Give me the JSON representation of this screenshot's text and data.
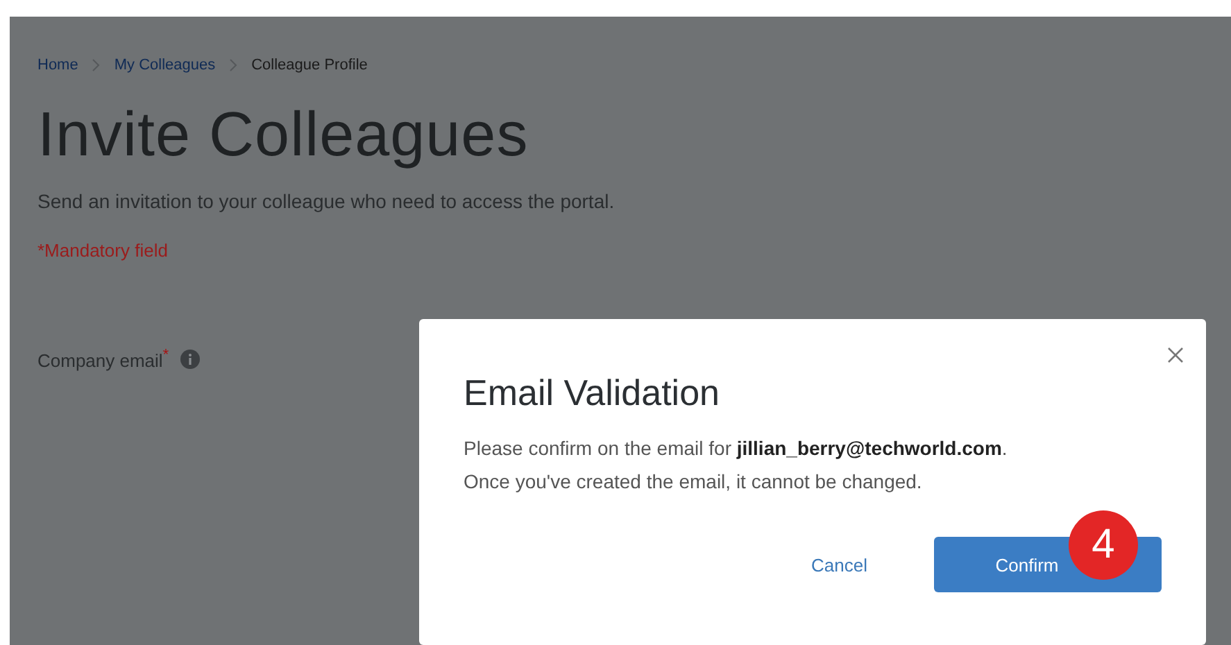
{
  "breadcrumb": [
    {
      "label": "Home",
      "current": false
    },
    {
      "label": "My Colleagues",
      "current": false
    },
    {
      "label": "Colleague Profile",
      "current": true
    }
  ],
  "page_title": "Invite Colleagues",
  "description": "Send an invitation to your colleague who need to access the portal.",
  "mandatory_note": "*Mandatory field",
  "fields": [
    {
      "label": "Company email$^{*}$"
    }
  ],
  "dialog": {
    "title": "Email Validation",
    "message_lines": [
      "Please confirm on the email for **jillian_berry@techworld.com**.",
      "Once you've created the email, it cannot be changed."
    ],
    "buttons": [
      {
        "label": "Cancel",
        "kind": "link"
      },
      {
        "label": "Confirm",
        "kind": "primary"
      }
    ]
  },
  "step_badge": "4"
}
